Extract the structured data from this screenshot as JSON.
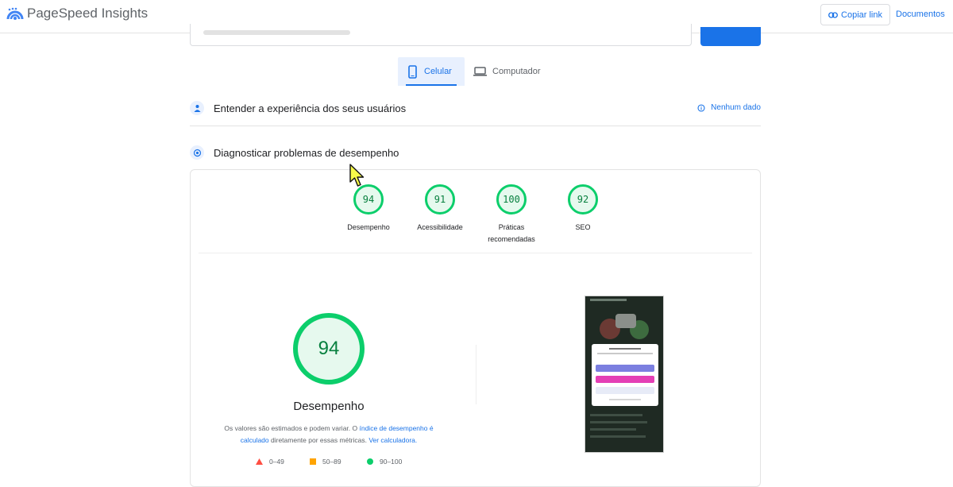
{
  "header": {
    "app_title": "PageSpeed Insights",
    "copy_link_label": "Copiar link",
    "docs_label": "Documentos",
    "logo_icon": "pagespeed-logo-icon",
    "copy_icon": "link-icon"
  },
  "device_tabs": [
    {
      "label": "Celular",
      "icon": "smartphone-icon",
      "selected": true
    },
    {
      "label": "Computador",
      "icon": "laptop-icon",
      "selected": false
    }
  ],
  "sections": {
    "field_data": {
      "title": "Entender a experiência dos seus usuários",
      "status": "Nenhum dado",
      "status_icon": "info-icon"
    },
    "lab_data": {
      "title": "Diagnosticar problemas de desempenho"
    }
  },
  "scores": [
    {
      "value": "94",
      "label": "Desempenho"
    },
    {
      "value": "91",
      "label": "Acessibilidade"
    },
    {
      "value": "100",
      "label": "Práticas recomendadas"
    },
    {
      "value": "92",
      "label": "SEO"
    }
  ],
  "performance": {
    "score": "94",
    "title": "Desempenho",
    "note_part1": "Os valores são estimados e podem variar. O ",
    "note_link1": "índice de desempenho é calculado",
    "note_part2": " diretamente por essas métricas. ",
    "note_link2": "Ver calculadora."
  },
  "legend": [
    {
      "range": "0–49",
      "color": "#ff4e42",
      "shape": "triangle"
    },
    {
      "range": "50–89",
      "color": "#ffa400",
      "shape": "square"
    },
    {
      "range": "90–100",
      "color": "#0cce6b",
      "shape": "circle"
    }
  ],
  "colors": {
    "accent": "#1a73e8",
    "pass_green": "#0cce6b",
    "pass_green_text": "#08803f",
    "pass_bg": "#e6f9ee"
  }
}
